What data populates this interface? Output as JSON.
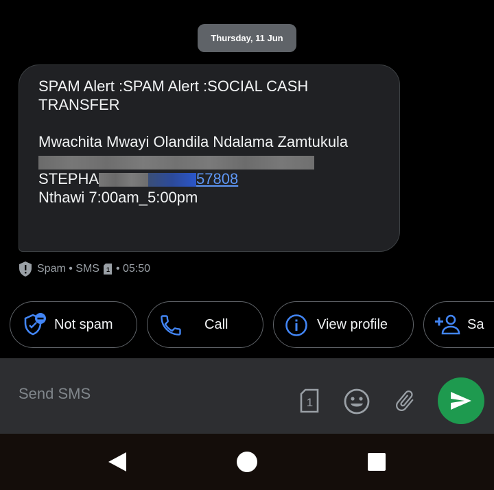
{
  "date_label": "Thursday, 11 Jun",
  "message": {
    "line1": "SPAM Alert :SPAM Alert :SOCIAL CASH",
    "line2": "TRANSFER",
    "line3": "Mwachita Mwayi Olandila Ndalama Zamtukula",
    "name_prefix": "STEPHA",
    "phone_suffix": "57808",
    "line5": "Nthawi 7:00am_5:00pm"
  },
  "meta": {
    "label": "Spam • SMS",
    "sim_number": "1",
    "time": "• 05:50"
  },
  "chips": [
    {
      "label": "Not spam"
    },
    {
      "label": "Call"
    },
    {
      "label": "View profile"
    },
    {
      "label": "Sa"
    }
  ],
  "composer": {
    "placeholder": "Send SMS",
    "sim_number": "1"
  },
  "colors": {
    "accent_blue": "#4285f4",
    "send_green": "#1e9a4f",
    "bubble_bg": "#202124"
  }
}
